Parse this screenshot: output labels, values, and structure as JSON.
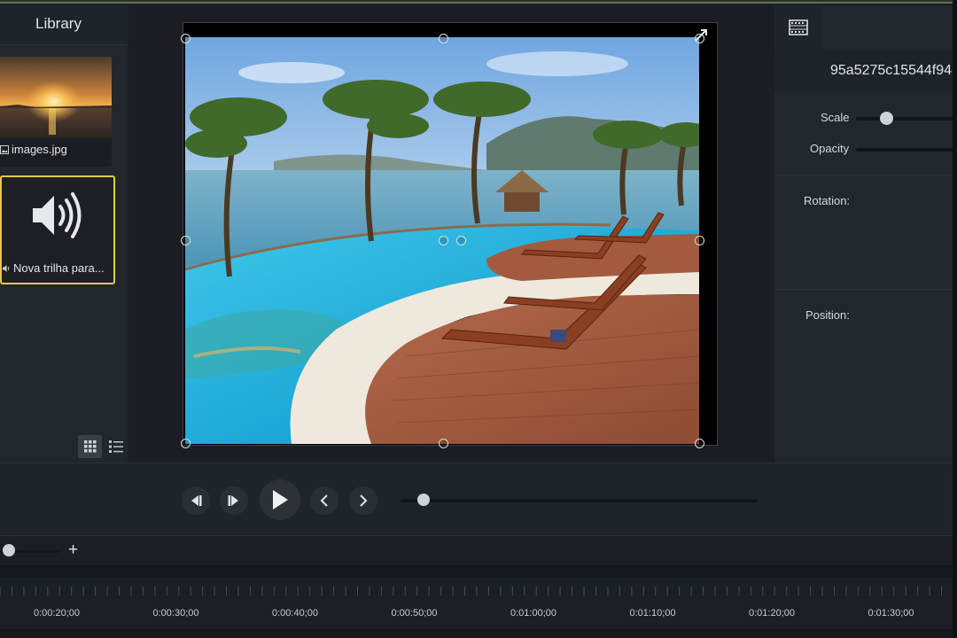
{
  "library": {
    "title": "Library",
    "items": [
      {
        "label": "images.jpg",
        "type": "image"
      },
      {
        "label": "Nova trilha para...",
        "type": "audio"
      }
    ]
  },
  "properties": {
    "clip_name": "95a5275c15544f94",
    "scale_label": "Scale",
    "opacity_label": "Opacity",
    "rotation_label": "Rotation:",
    "position_label": "Position:"
  },
  "timeline": {
    "ticks": [
      "0:00:20;00",
      "0:00:30;00",
      "0:00:40;00",
      "0:00:50;00",
      "0:01:00;00",
      "0:01:10;00",
      "0:01:20;00",
      "0:01:30;00"
    ]
  },
  "zoom": {
    "plus_label": "+"
  },
  "colors": {
    "accent": "#8fb24a",
    "selection": "#e6c84a"
  },
  "icons": [
    "image-file-icon",
    "speaker-icon",
    "grid-view-icon",
    "list-view-icon",
    "film-icon",
    "step-back-icon",
    "step-forward-icon",
    "play-icon",
    "prev-icon",
    "next-icon"
  ]
}
